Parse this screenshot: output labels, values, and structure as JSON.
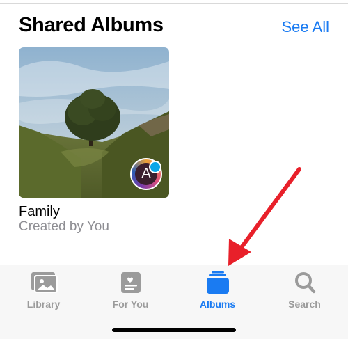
{
  "section": {
    "title": "Shared Albums",
    "see_all_label": "See All"
  },
  "albums": [
    {
      "title": "Family",
      "subtitle": "Created by You",
      "avatar_letter": "A"
    }
  ],
  "tab_bar": {
    "tabs": [
      {
        "label": "Library",
        "icon": "photo-library-icon",
        "active": false
      },
      {
        "label": "For You",
        "icon": "for-you-icon",
        "active": false
      },
      {
        "label": "Albums",
        "icon": "albums-icon",
        "active": true
      },
      {
        "label": "Search",
        "icon": "search-icon",
        "active": false
      }
    ]
  },
  "colors": {
    "accent": "#1a7bf2",
    "inactive_tab": "#9b9b9b",
    "annotation_arrow": "#e8202a"
  }
}
